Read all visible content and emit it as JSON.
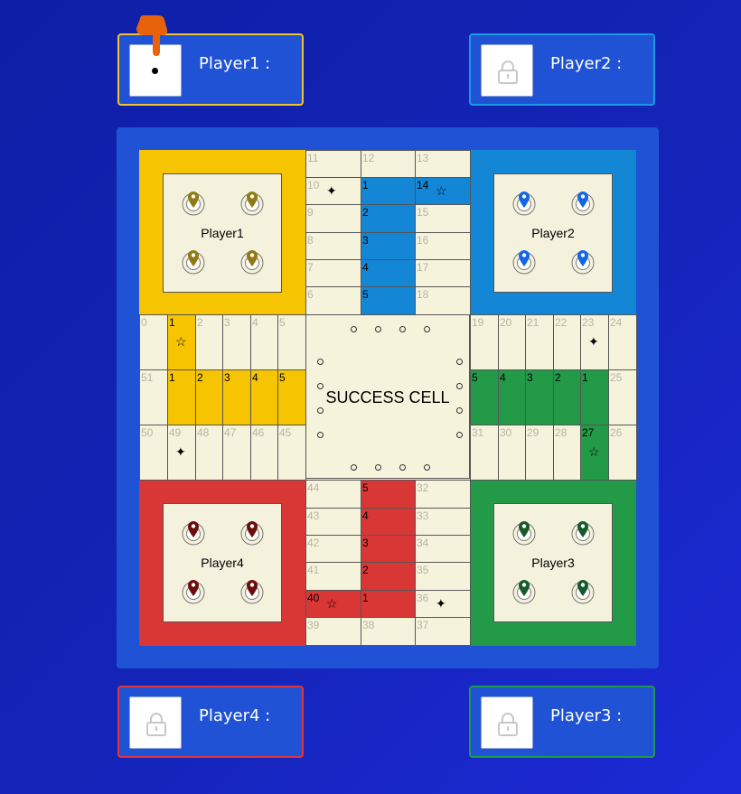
{
  "players_top": [
    {
      "name": "Player1 :",
      "state": "active",
      "die_value": 1,
      "border_color": "#f1c232"
    },
    {
      "name": "Player2 :",
      "state": "locked",
      "border_color": "#1a9ae0"
    }
  ],
  "players_bottom": [
    {
      "name": "Player4 :",
      "state": "locked",
      "border_color": "#e0353a"
    },
    {
      "name": "Player3 :",
      "state": "locked",
      "border_color": "#1e9a4a"
    }
  ],
  "turn_pointer_icon": "pointing-hand-icon",
  "colors": {
    "yellow": "#f6c400",
    "blue": "#1486d6",
    "red": "#d93636",
    "green": "#239a48",
    "cream": "#f6f3dc",
    "yellow_piece": "#8f7a14",
    "blue_piece": "#1466e6",
    "red_piece": "#6b0d0d",
    "green_piece": "#165a2c"
  },
  "homes": {
    "yellow": {
      "label": "Player1"
    },
    "blue": {
      "label": "Player2"
    },
    "green": {
      "label": "Player3"
    },
    "red": {
      "label": "Player4"
    }
  },
  "center": {
    "label": "SUCCESS CELL"
  },
  "cells": {
    "top_left_column": [
      "11",
      "10",
      "9",
      "8",
      "7",
      "6"
    ],
    "top_center_column": [
      "12",
      "1",
      "2",
      "3",
      "4",
      "5"
    ],
    "top_right_column": [
      "13",
      "14",
      "15",
      "16",
      "17",
      "18"
    ],
    "left_top_row": [
      "0",
      "1",
      "2",
      "3",
      "4",
      "5"
    ],
    "left_middle_row": [
      "51",
      "1",
      "2",
      "3",
      "4",
      "5"
    ],
    "left_bottom_row": [
      "50",
      "49",
      "48",
      "47",
      "46",
      "45"
    ],
    "right_top_row": [
      "19",
      "20",
      "21",
      "22",
      "23",
      "24"
    ],
    "right_middle_row": [
      "5",
      "4",
      "3",
      "2",
      "1",
      "25"
    ],
    "right_bottom_row": [
      "31",
      "30",
      "29",
      "28",
      "27",
      "26"
    ],
    "bottom_left_column": [
      "44",
      "43",
      "42",
      "41",
      "40",
      "39"
    ],
    "bottom_center_column": [
      "5",
      "4",
      "3",
      "2",
      "1",
      "38"
    ],
    "bottom_right_column": [
      "32",
      "33",
      "34",
      "35",
      "36",
      "37"
    ]
  }
}
